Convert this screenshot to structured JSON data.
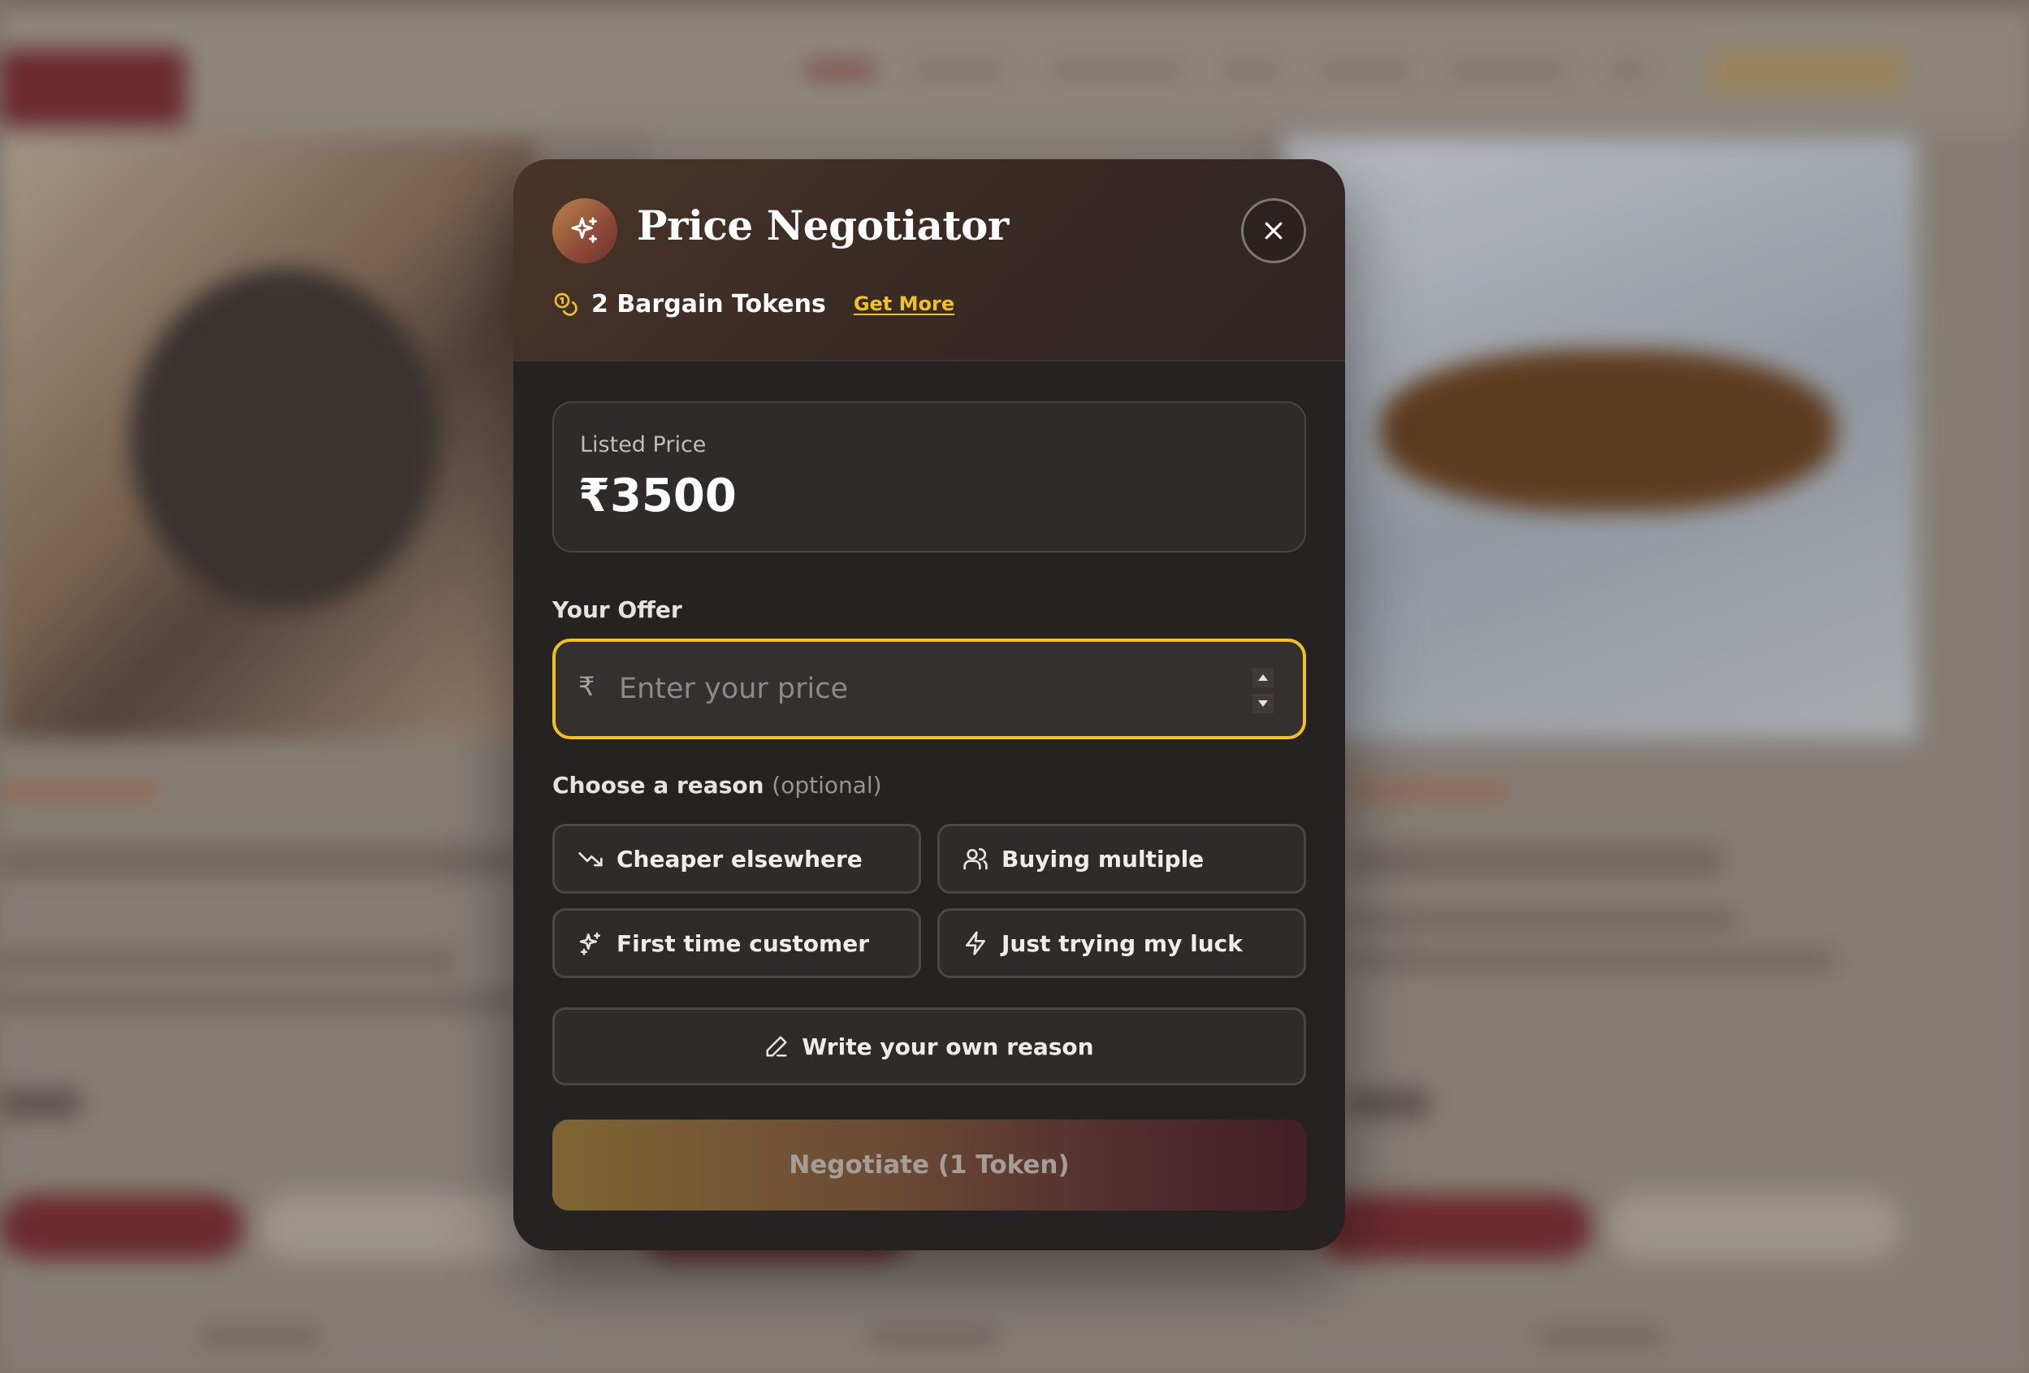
{
  "modal": {
    "title": "Price Negotiator",
    "tokens_label": "2 Bargain Tokens",
    "get_more": "Get More",
    "listed_price_label": "Listed Price",
    "listed_price": "₹3500",
    "offer_label": "Your Offer",
    "currency_prefix": "₹",
    "offer_placeholder": "Enter your price",
    "offer_value": "",
    "reason_label": "Choose a reason",
    "reason_optional": "(optional)",
    "reasons": [
      {
        "label": "Cheaper elsewhere",
        "icon": "trending-down-icon"
      },
      {
        "label": "Buying multiple",
        "icon": "users-icon"
      },
      {
        "label": "First time customer",
        "icon": "sparkles-icon"
      },
      {
        "label": "Just trying my luck",
        "icon": "lightning-icon"
      }
    ],
    "write_own": "Write your own reason",
    "submit_label": "Negotiate (1 Token)"
  },
  "colors": {
    "accent": "#f2c21b",
    "modal_bg": "#262221",
    "brand_red": "#7a2d33"
  }
}
